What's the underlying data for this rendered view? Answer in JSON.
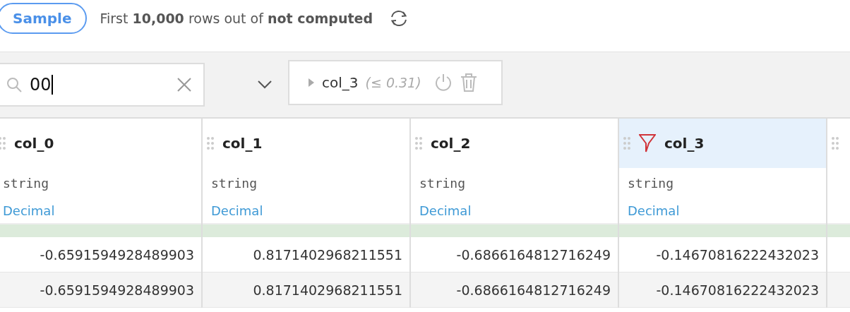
{
  "sample_button": "Sample",
  "summary": "First **10,000** rows out of **not computed**",
  "search": {
    "value": "00"
  },
  "filter_chip": {
    "column": "col_3",
    "condition": "(≤ 0.31)",
    "expanded": false
  },
  "columns": [
    {
      "name": "col_0",
      "storage": "string",
      "meaning": "Decimal",
      "filtered": false
    },
    {
      "name": "col_1",
      "storage": "string",
      "meaning": "Decimal",
      "filtered": false
    },
    {
      "name": "col_2",
      "storage": "string",
      "meaning": "Decimal",
      "filtered": false
    },
    {
      "name": "col_3",
      "storage": "string",
      "meaning": "Decimal",
      "filtered": true
    }
  ],
  "rows": [
    [
      "-0.6591594928489903",
      "0.8171402968211551",
      "-0.6866164812716249",
      "-0.14670816222432023"
    ],
    [
      "-0.6591594928489903",
      "0.8171402968211551",
      "-0.6866164812716249",
      "-0.14670816222432023"
    ]
  ]
}
